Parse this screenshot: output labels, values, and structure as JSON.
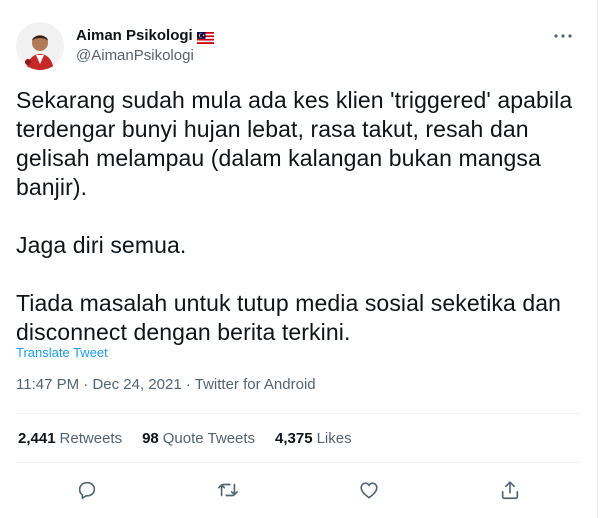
{
  "author": {
    "display_name": "Aiman Psikologi",
    "handle": "@AimanPsikologi",
    "flag_icon": "malaysia-flag-icon"
  },
  "tweet": {
    "paragraphs": [
      "Sekarang sudah mula ada kes klien 'triggered' apabila terdengar bunyi hujan lebat, rasa takut, resah dan gelisah melampau (dalam kalangan bukan mangsa banjir).",
      "Jaga diri semua.",
      "Tiada masalah untuk tutup media sosial seketika dan disconnect dengan berita terkini."
    ],
    "translate_label": "Translate Tweet",
    "time": "11:47 PM",
    "date": "Dec 24, 2021",
    "source": "Twitter for Android",
    "meta_separator": " · "
  },
  "stats": {
    "retweets_count": "2,441",
    "retweets_label": "Retweets",
    "quotes_count": "98",
    "quotes_label": "Quote Tweets",
    "likes_count": "4,375",
    "likes_label": "Likes"
  },
  "actions": [
    {
      "icon": "reply-icon"
    },
    {
      "icon": "retweet-icon"
    },
    {
      "icon": "like-icon"
    },
    {
      "icon": "share-icon"
    }
  ],
  "colors": {
    "text": "#0f1419",
    "secondary": "#536471",
    "link": "#1d9bf0",
    "divider": "#eff3f4"
  }
}
